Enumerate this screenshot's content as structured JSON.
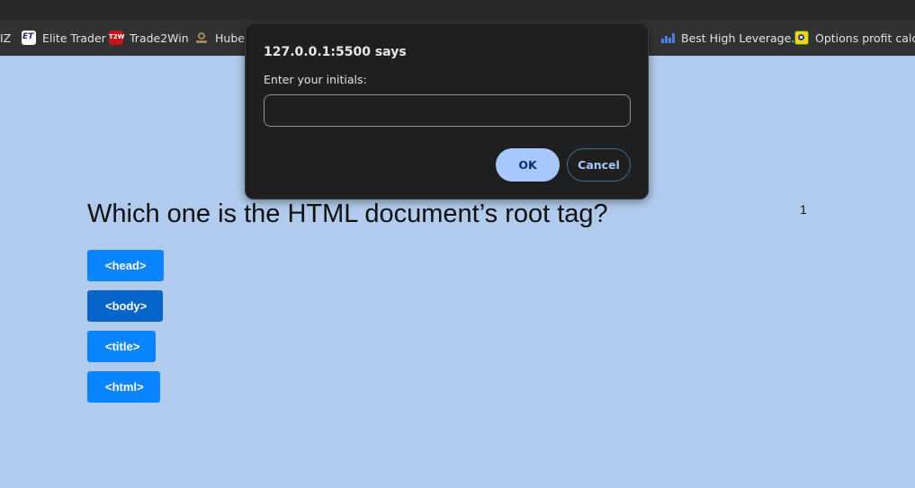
{
  "bookmarks": [
    {
      "label": "IZ",
      "icon": "none"
    },
    {
      "label": "Elite Trader",
      "icon": "elite-trader-icon"
    },
    {
      "label": "Trade2Win",
      "icon": "trade2win-icon"
    },
    {
      "label": "Huber",
      "icon": "huber-icon"
    },
    {
      "label": "Best High Leverage...",
      "icon": "bar-chart-icon"
    },
    {
      "label": "Options profit calcu...",
      "icon": "options-calculator-icon"
    }
  ],
  "quiz": {
    "question": "Which one is the HTML document’s root tag?",
    "counter": "1",
    "answers": [
      "<head>",
      "<body>",
      "<title>",
      "<html>"
    ]
  },
  "dialog": {
    "title": "127.0.0.1:5500 says",
    "message": "Enter your initials:",
    "input_value": "",
    "ok_label": "OK",
    "cancel_label": "Cancel"
  },
  "colors": {
    "page_background": "#b0cbeb",
    "answer_button": "#0a84ff",
    "answer_button_hover": "#0764c8",
    "dialog_background": "#1f1f1f",
    "dialog_ok": "#a8c7fa"
  }
}
